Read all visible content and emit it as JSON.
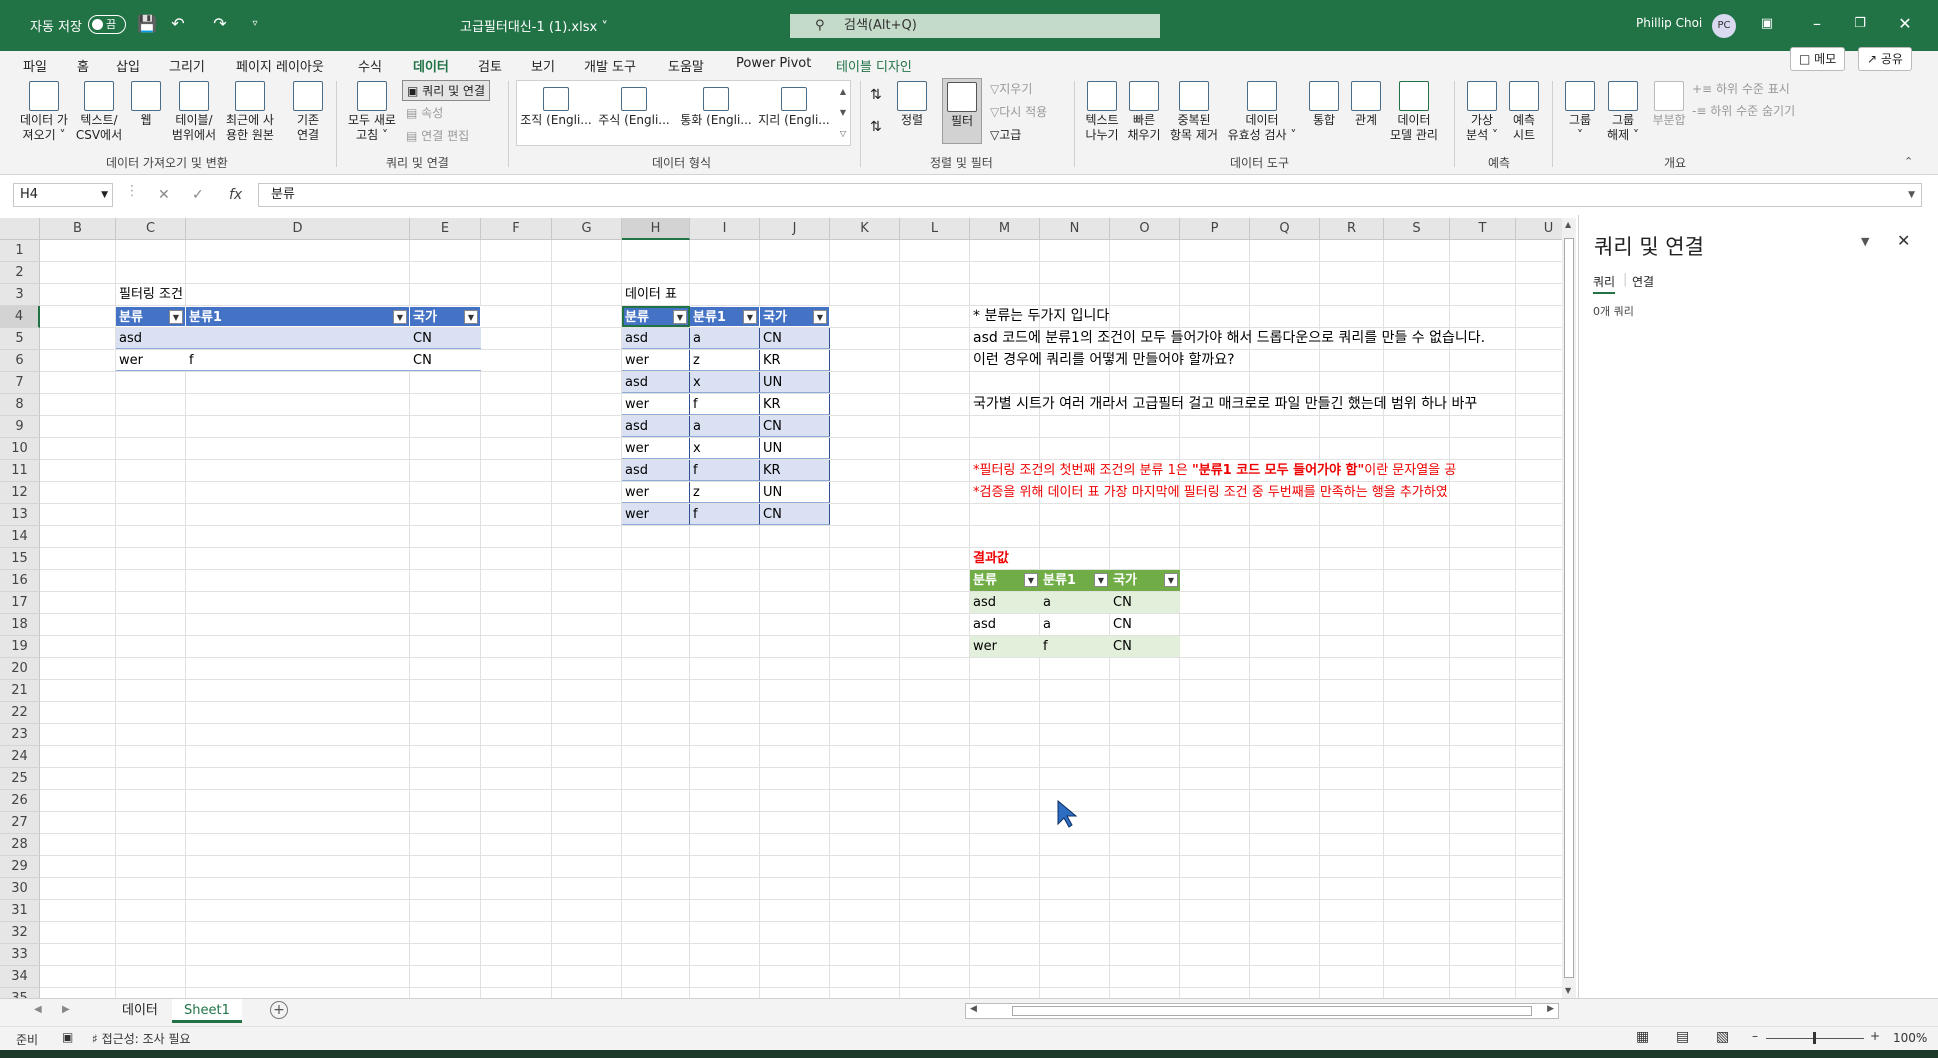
{
  "titlebar": {
    "autosave_label": "자동 저장",
    "autosave_state": "끔",
    "filename": "고급필터대신-1 (1).xlsx",
    "search_placeholder": "검색(Alt+Q)",
    "user_name": "Phillip Choi",
    "user_initials": "PC"
  },
  "menu": {
    "items": [
      "파일",
      "홈",
      "삽입",
      "그리기",
      "페이지 레이아웃",
      "수식",
      "데이터",
      "검토",
      "보기",
      "개발 도구",
      "도움말",
      "Power Pivot",
      "테이블 디자인"
    ],
    "active": "데이터",
    "memo_button": "메모",
    "share_button": "공유"
  },
  "ribbon": {
    "group_get": {
      "label": "데이터 가져오기 및 변환",
      "buttons": [
        "데이터 가\n져오기 ˅",
        "텍스트/\nCSV에서",
        "웹",
        "테이블/\n범위에서",
        "최근에 사\n용한 원본",
        "기존\n연결"
      ]
    },
    "group_query": {
      "label": "쿼리 및 연결",
      "refresh_all": "모두 새로\n고침 ˅",
      "queries_connections": "쿼리 및 연결",
      "properties": "속성",
      "edit_links": "연결 편집"
    },
    "group_types": {
      "label": "데이터 형식",
      "types": [
        "조직 (Engli...",
        "주식 (Engli...",
        "통화 (Engli...",
        "지리 (Engli..."
      ]
    },
    "group_sort": {
      "label": "정렬 및 필터",
      "sort": "정렬",
      "filter": "필터",
      "clear": "지우기",
      "reapply": "다시 적용",
      "advanced": "고급"
    },
    "group_tools": {
      "label": "데이터 도구",
      "buttons": [
        "텍스트\n나누기",
        "빠른\n채우기",
        "중복된\n항목 제거",
        "데이터\n유효성 검사 ˅",
        "통합",
        "관계",
        "데이터\n모델 관리"
      ]
    },
    "group_forecast": {
      "label": "예측",
      "buttons": [
        "가상\n분석 ˅",
        "예측\n시트"
      ]
    },
    "group_outline": {
      "label": "개요",
      "buttons": [
        "그룹\n˅",
        "그룹\n해제 ˅",
        "부분합"
      ],
      "show_detail": "하위 수준 표시",
      "hide_detail": "하위 수준 숨기기"
    }
  },
  "formula_bar": {
    "name_box": "H4",
    "fx": "fx",
    "value": "분류"
  },
  "columns": [
    "B",
    "C",
    "D",
    "E",
    "F",
    "G",
    "H",
    "I",
    "J",
    "K",
    "L",
    "M",
    "N",
    "O",
    "P",
    "Q",
    "R",
    "S",
    "T",
    "U"
  ],
  "rows": [
    "1",
    "2",
    "3",
    "4",
    "5",
    "6",
    "7",
    "8",
    "9",
    "10",
    "11",
    "12",
    "13",
    "14",
    "15",
    "16",
    "17",
    "18",
    "19",
    "20",
    "21",
    "22",
    "23",
    "24",
    "25",
    "26",
    "27",
    "28",
    "29",
    "30",
    "31",
    "32",
    "33",
    "34",
    "35"
  ],
  "sheet": {
    "filter_title": "필터링 조건",
    "filter_table": {
      "headers": [
        "분류",
        "분류1",
        "국가"
      ],
      "rows": [
        [
          "asd",
          "",
          "CN"
        ],
        [
          "wer",
          "f",
          "CN"
        ]
      ]
    },
    "data_title": "데이터 표",
    "data_table": {
      "headers": [
        "분류",
        "분류1",
        "국가"
      ],
      "rows": [
        [
          "asd",
          "a",
          "CN"
        ],
        [
          "wer",
          "z",
          "KR"
        ],
        [
          "asd",
          "x",
          "UN"
        ],
        [
          "wer",
          "f",
          "KR"
        ],
        [
          "asd",
          "a",
          "CN"
        ],
        [
          "wer",
          "x",
          "UN"
        ],
        [
          "asd",
          "f",
          "KR"
        ],
        [
          "wer",
          "z",
          "UN"
        ],
        [
          "wer",
          "f",
          "CN"
        ]
      ]
    },
    "notes": [
      "* 분류는 두가지 입니다",
      "asd 코드에 분류1의 조건이 모두 들어가야 해서 드롭다운으로 쿼리를 만들 수 없습니다.",
      "이런 경우에 쿼리를 어떻게 만들어야 할까요?",
      "국가별 시트가 여러 개라서 고급필터 걸고 매크로로 파일 만들긴 했는데 범위 하나 바꾸",
      "*필터링 조건의 첫번째 조건의 분류 1은 ",
      "\"분류1 코드 모두 들어가야 함\"",
      "이란 문자열을 공",
      "*검증을 위해 데이터 표 가장 마지막에 필터링 조건 중 두번째를 만족하는 행을 추가하였"
    ],
    "result_title": "결과값",
    "result_table": {
      "headers": [
        "분류",
        "분류1",
        "국가"
      ],
      "rows": [
        [
          "asd",
          "a",
          "CN"
        ],
        [
          "asd",
          "a",
          "CN"
        ],
        [
          "wer",
          "f",
          "CN"
        ]
      ]
    }
  },
  "side_pane": {
    "title": "쿼리 및 연결",
    "tabs": [
      "쿼리",
      "연결"
    ],
    "count": "0개 쿼리"
  },
  "sheet_tabs": [
    "데이터",
    "Sheet1"
  ],
  "active_sheet": "Sheet1",
  "status": {
    "ready": "준비",
    "accessibility": "접근성: 조사 필요",
    "zoom": "100%"
  },
  "colors": {
    "excel_green": "#217346",
    "table_blue": "#4472c4",
    "table_green": "#70ad47",
    "note_red": "#e00000"
  }
}
